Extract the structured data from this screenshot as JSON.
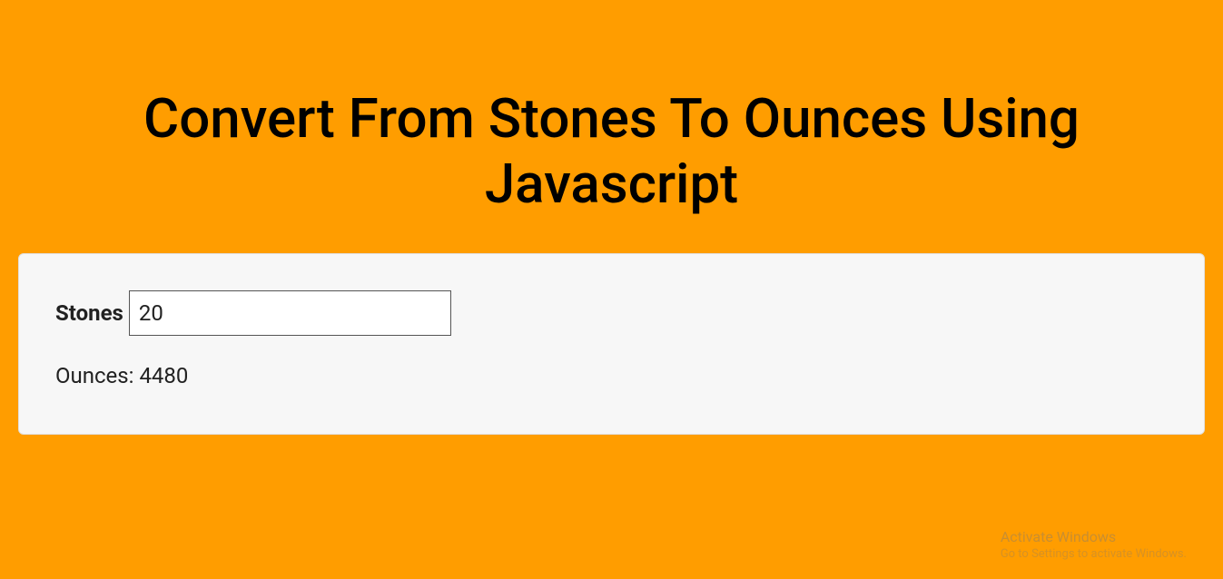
{
  "title": "Convert From Stones To Ounces Using Javascript",
  "form": {
    "input_label": "Stones",
    "input_value": "20",
    "output_label": "Ounces:",
    "output_value": "4480"
  },
  "watermark": {
    "line1": "Activate Windows",
    "line2": "Go to Settings to activate Windows."
  },
  "colors": {
    "background": "#ff9d00",
    "card": "#f7f7f7"
  }
}
